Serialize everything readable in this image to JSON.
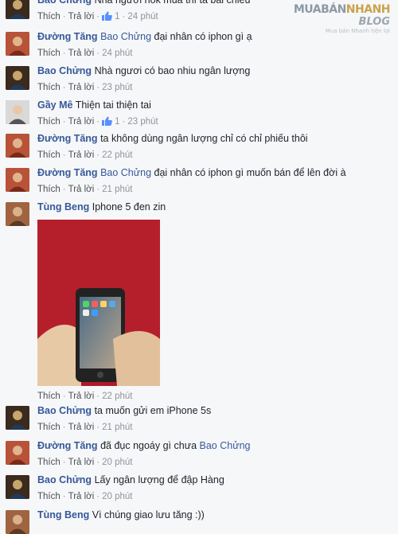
{
  "watermark": {
    "brand": "MUABÁN",
    "brand_accent": "NHANH",
    "sub": "BLOG",
    "tagline": "Mua bán Nhanh tiện lợi"
  },
  "actions": {
    "like": "Thích",
    "reply": "Trả lời",
    "separator": "·"
  },
  "colors": {
    "author_link": "#365899",
    "meta": "#90949c",
    "photo_bg": "#b21d2c"
  },
  "comments": [
    {
      "author": "Bao Chửng",
      "mention": "",
      "text": "Nhà ngươi hok mua thì ta bái chiêu",
      "likes": "1",
      "time": "24 phút",
      "avatar_icon": "bao-chung-avatar-icon"
    },
    {
      "author": "Đường Tăng",
      "mention": "Bao Chửng",
      "text": "đại nhân có iphon gì ạ",
      "likes": "",
      "time": "24 phút",
      "avatar_icon": "duong-tang-avatar-icon"
    },
    {
      "author": "Bao Chửng",
      "mention": "",
      "text": "Nhà ngươi có bao nhiu ngân lượng",
      "likes": "",
      "time": "23 phút",
      "avatar_icon": "bao-chung-avatar-icon"
    },
    {
      "author": "Gầy Mê",
      "mention": "",
      "text": "Thiện tai thiện tai",
      "likes": "1",
      "time": "23 phút",
      "avatar_icon": "gay-me-avatar-icon"
    },
    {
      "author": "Đường Tăng",
      "mention": "",
      "text": "ta không dùng ngân lượng chỉ có chỉ phiếu thôi",
      "likes": "",
      "time": "22 phút",
      "avatar_icon": "duong-tang-avatar-icon"
    },
    {
      "author": "Đường Tăng",
      "mention": "Bao Chửng",
      "text": "đại nhân có iphon gì muốn bán để lên đời à",
      "likes": "",
      "time": "21 phút",
      "avatar_icon": "duong-tang-avatar-icon"
    },
    {
      "author": "Tùng Beng",
      "mention": "",
      "text": "Iphone 5 đen zin",
      "likes": "",
      "time": "22 phút",
      "avatar_icon": "tung-beng-avatar-icon",
      "photo": true
    },
    {
      "author": "Bao Chửng",
      "mention": "",
      "text": "ta muốn gửi em iPhone 5s",
      "likes": "",
      "time": "21 phút",
      "avatar_icon": "bao-chung-avatar-icon"
    },
    {
      "author": "Đường Tăng",
      "mention": "",
      "text": "đã đục ngoáy gì chưa",
      "mention_after": "Bao Chửng",
      "likes": "",
      "time": "20 phút",
      "avatar_icon": "duong-tang-avatar-icon"
    },
    {
      "author": "Bao Chửng",
      "mention": "",
      "text": "Lấy ngân lượng để đập Hàng",
      "likes": "",
      "time": "20 phút",
      "avatar_icon": "bao-chung-avatar-icon"
    },
    {
      "author": "Tùng Beng",
      "mention": "",
      "text": "Vì chúng giao lưu tăng :))",
      "likes": "",
      "time": "",
      "avatar_icon": "tung-beng-avatar-icon"
    }
  ]
}
